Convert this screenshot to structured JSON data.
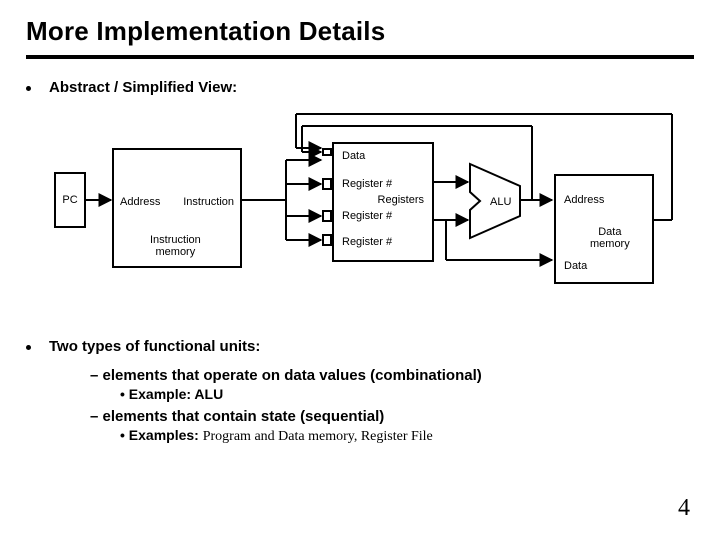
{
  "title": "More Implementation Details",
  "bullets": {
    "abstract": "Abstract / Simplified View:",
    "twotypes": "Two types of functional units:",
    "sub_combinational": "elements that operate on data values (combinational)",
    "sub_combinational_ex": "Example: ALU",
    "sub_sequential": "elements that contain state (sequential)",
    "sub_sequential_ex_lead": "Examples: ",
    "sub_sequential_ex_rest": "Program and Data memory, Register File"
  },
  "diagram": {
    "pc": "PC",
    "imem_addr": "Address",
    "imem_name": "Instruction\nmemory",
    "imem_out": "Instruction",
    "reg_data": "Data",
    "reg_r1": "Register #",
    "reg_name": "Registers",
    "reg_r2": "Register #",
    "reg_r3": "Register #",
    "alu": "ALU",
    "dmem_addr": "Address",
    "dmem_name": "Data\nmemory",
    "dmem_data": "Data"
  },
  "page_number": "4"
}
